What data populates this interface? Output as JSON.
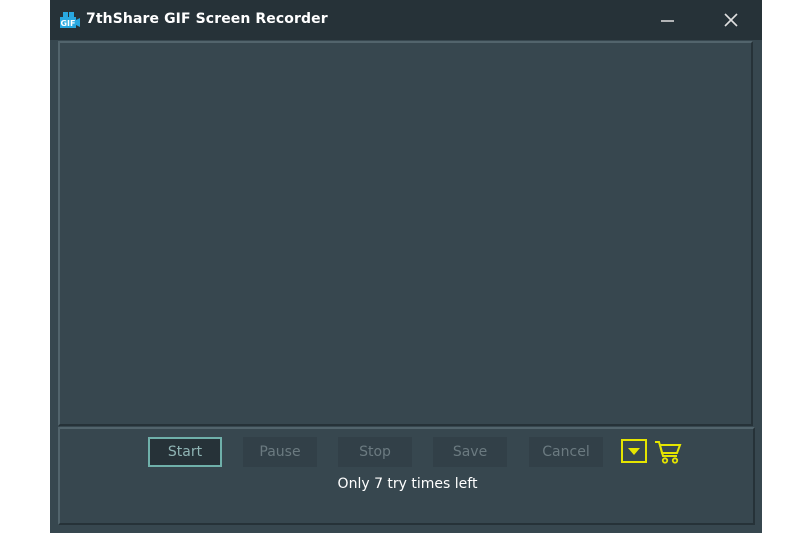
{
  "window": {
    "title": "7thShare GIF Screen Recorder",
    "app_icon_text": "GIF",
    "minimize_icon": "minimize-icon",
    "close_icon": "close-icon"
  },
  "controls": {
    "buttons": [
      {
        "label": "Start",
        "state": "enabled"
      },
      {
        "label": "Pause",
        "state": "disabled"
      },
      {
        "label": "Stop",
        "state": "disabled"
      },
      {
        "label": "Save",
        "state": "disabled"
      },
      {
        "label": "Cancel",
        "state": "disabled"
      }
    ],
    "dropdown_icon": "dropdown-arrow-icon",
    "cart_icon": "shopping-cart-icon",
    "trial_message": "Only 7 try times left"
  },
  "colors": {
    "titlebar": "#263238",
    "body": "#37474f",
    "accent_start": "#6fb0aa",
    "accent_yellow": "#e5e500"
  }
}
